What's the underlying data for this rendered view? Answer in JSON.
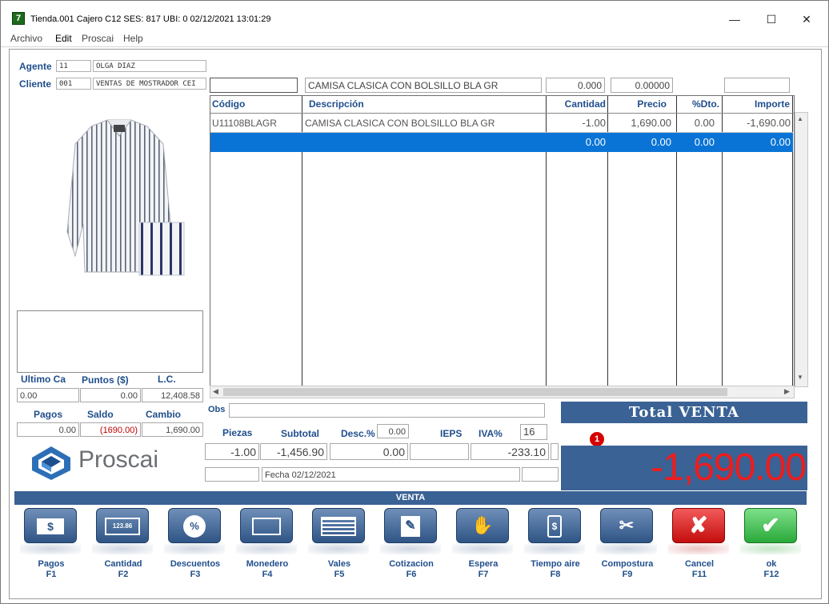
{
  "window": {
    "title": "Tienda.001  Cajero C12    SES: 817  UBI: 0  02/12/2021 13:01:29",
    "app_icon": "7",
    "controls": [
      "minimize-icon",
      "maximize-icon",
      "close-icon"
    ]
  },
  "menu": [
    "Archivo",
    "Edit",
    "Proscai",
    "Help"
  ],
  "agent": {
    "label": "Agente",
    "code": "11",
    "name": "OLGA DIAZ"
  },
  "client": {
    "label": "Cliente",
    "code": "001",
    "name": "VENTAS DE MOSTRADOR CEI"
  },
  "entry": {
    "code": "",
    "description": "CAMISA CLASICA CON BOLSILLO BLA GR",
    "qty": "0.000",
    "price": "0.00000",
    "extra": ""
  },
  "grid": {
    "headers": [
      "Código",
      "Descripción",
      "Cantidad",
      "Precio",
      "%Dto.",
      "Importe"
    ],
    "rows": [
      [
        "U11108BLAGR",
        "CAMISA CLASICA CON BOLSILLO BLA GR",
        "-1.00",
        "1,690.00",
        "0.00",
        "-1,690.00"
      ]
    ],
    "selected": [
      "",
      "",
      "0.00",
      "0.00",
      "0.00",
      "0.00"
    ]
  },
  "summary": {
    "labels": [
      "Ultimo Ca",
      "Puntos ($)",
      "L.C."
    ],
    "values": [
      "0.00",
      "0.00",
      "12,408.58"
    ],
    "labels2": [
      "Pagos",
      "Saldo",
      "Cambio"
    ],
    "values2": [
      "0.00",
      "(1690.00)",
      "1,690.00"
    ]
  },
  "obs_label": "Obs",
  "totals": {
    "labels": [
      "Piezas",
      "Subtotal",
      "Desc.%",
      "IEPS",
      "IVA%"
    ],
    "desc_pct": "0.00",
    "iva_pct": "16",
    "values": [
      "-1.00",
      "-1,456.90",
      "0.00",
      "",
      "-233.10"
    ],
    "date": "Fecha 02/12/2021"
  },
  "total_venta": {
    "label": "Total VENTA",
    "amount": "-1,690.00",
    "badge": "1"
  },
  "brand": "Proscai",
  "section": "VENTA",
  "toolbar": [
    {
      "label": "Pagos",
      "key": "F1",
      "icon": "money-icon"
    },
    {
      "label": "Cantidad",
      "key": "F2",
      "icon": "calculator-icon"
    },
    {
      "label": "Descuentos",
      "key": "F3",
      "icon": "percent-icon"
    },
    {
      "label": "Monedero",
      "key": "F4",
      "icon": "card-icon"
    },
    {
      "label": "Vales",
      "key": "F5",
      "icon": "voucher-icon"
    },
    {
      "label": "Cotizacion",
      "key": "F6",
      "icon": "quote-icon"
    },
    {
      "label": "Espera",
      "key": "F7",
      "icon": "hand-icon"
    },
    {
      "label": "Tiempo aire",
      "key": "F8",
      "icon": "phone-icon"
    },
    {
      "label": "Compostura",
      "key": "F9",
      "icon": "scissors-icon"
    },
    {
      "label": "Cancel",
      "key": "F11",
      "icon": "cancel-x-icon"
    },
    {
      "label": "ok",
      "key": "F12",
      "icon": "check-icon"
    }
  ]
}
